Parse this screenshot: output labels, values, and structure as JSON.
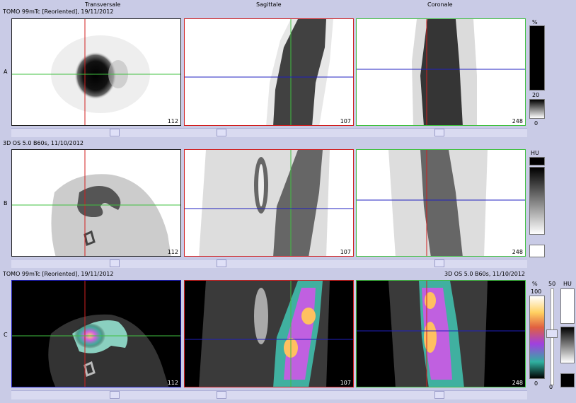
{
  "headers": {
    "col1": "Transversale",
    "col2": "Sagittale",
    "col3": "Coronale"
  },
  "rows": {
    "a": {
      "label": "A",
      "title": "TOMO 99mTc [Reoriented], 19/11/2012",
      "slices": [
        "112",
        "107",
        "248"
      ]
    },
    "b": {
      "label": "B",
      "title": "3D OS 5.0 B60s, 11/10/2012",
      "slices": [
        "112",
        "107",
        "248"
      ]
    },
    "c": {
      "label": "C",
      "title_left": "TOMO 99mTc [Reoriented], 19/11/2012",
      "title_right": "3D OS 5.0 B60s, 11/10/2012",
      "slices": [
        "112",
        "107",
        "248"
      ]
    }
  },
  "colorbars": {
    "a": {
      "unit": "%",
      "mid": "20",
      "low": "0"
    },
    "b": {
      "unit": "HU"
    },
    "c": {
      "unit": "%",
      "top": "100",
      "low": "0",
      "slider_label": "50",
      "slider_low": "0",
      "unit2": "HU"
    }
  },
  "colors": {
    "crosshair_vertical": "#d02020",
    "crosshair_horizontal_transverse": "#40c040",
    "crosshair_horizontal_other": "#2020c0",
    "background": "#c9cbe6"
  }
}
